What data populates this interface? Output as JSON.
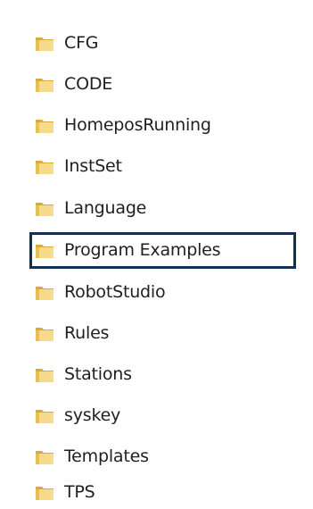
{
  "folders": [
    {
      "name": "CFG"
    },
    {
      "name": "CODE"
    },
    {
      "name": "HomeposRunning"
    },
    {
      "name": "InstSet"
    },
    {
      "name": "Language"
    },
    {
      "name": "Program Examples",
      "highlighted": true
    },
    {
      "name": "RobotStudio"
    },
    {
      "name": "Rules"
    },
    {
      "name": "Stations"
    },
    {
      "name": "syskey"
    },
    {
      "name": "Templates"
    },
    {
      "name": "TPS"
    }
  ],
  "icon": "folder-icon",
  "colors": {
    "highlight_border": "#14304e",
    "folder_light": "#f6dc8a",
    "folder_dark": "#d9a93a",
    "text": "#1f1f1f"
  }
}
